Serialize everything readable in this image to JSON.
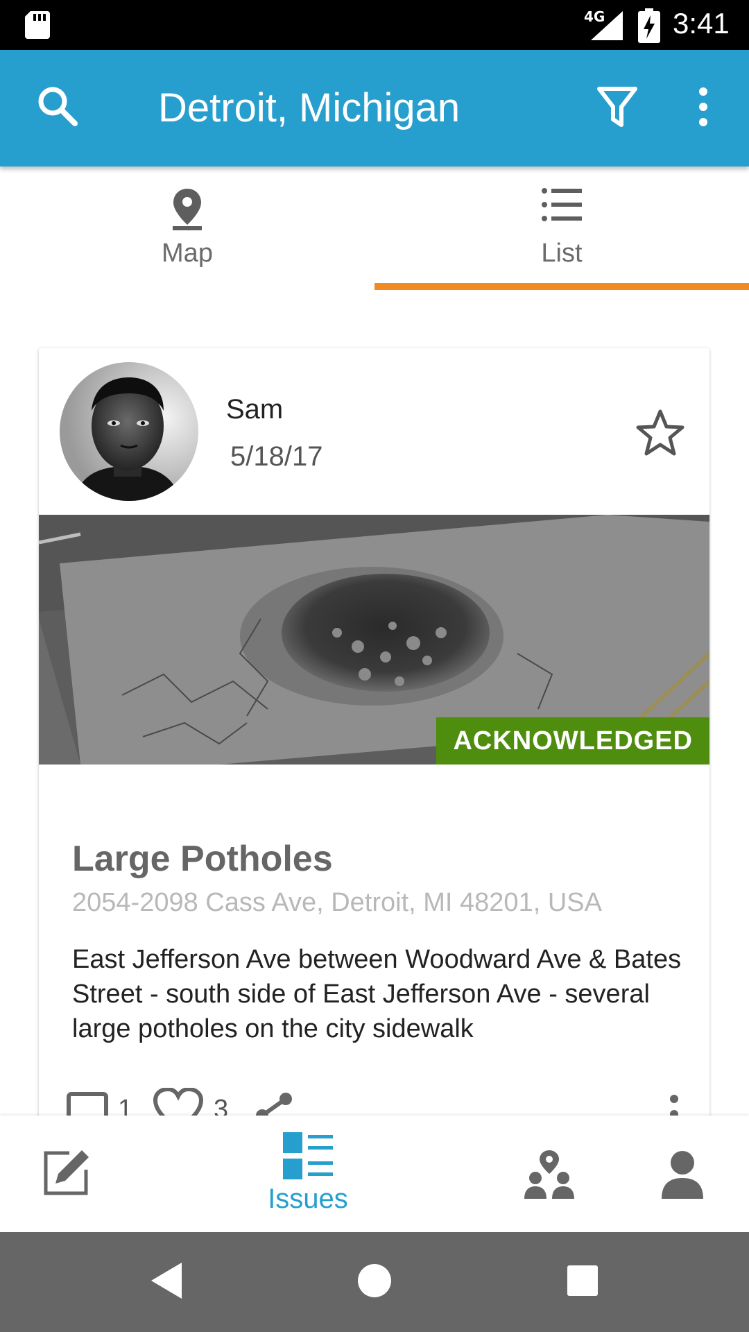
{
  "status_bar": {
    "network": "4G",
    "time": "3:41",
    "icons": [
      "sd-card-icon",
      "signal-icon",
      "battery-charging-icon"
    ]
  },
  "app_bar": {
    "title": "Detroit, Michigan",
    "icons": [
      "search-icon",
      "filter-icon",
      "more-vert-icon"
    ],
    "color": "#279fce"
  },
  "tabs": [
    {
      "label": "Map",
      "icon": "map-pin-icon",
      "selected": false
    },
    {
      "label": "List",
      "icon": "list-icon",
      "selected": true
    }
  ],
  "tab_indicator_color": "#f28a23",
  "card": {
    "user": {
      "name": "Sam",
      "date": "5/18/17"
    },
    "favorite_icon": "star-outline-icon",
    "status": "ACKNOWLEDGED",
    "status_color": "#4f8d0e",
    "title": "Large Potholes",
    "address": "2054-2098 Cass Ave, Detroit, MI 48201, USA",
    "description": "East Jefferson Ave between Woodward Ave & Bates Street - south side of East Jefferson Ave - several large potholes on the city sidewalk",
    "actions": {
      "comments": "1",
      "likes": "3",
      "icons": [
        "comment-icon",
        "heart-icon",
        "share-icon",
        "more-vert-icon"
      ]
    }
  },
  "bottom_nav": [
    {
      "label": "",
      "icon": "edit-icon",
      "active": false
    },
    {
      "label": "Issues",
      "icon": "issues-list-icon",
      "active": true
    },
    {
      "label": "",
      "icon": "community-icon",
      "active": false
    },
    {
      "label": "",
      "icon": "profile-icon",
      "active": false
    }
  ],
  "system_nav": [
    "back-icon",
    "home-icon",
    "recents-icon"
  ]
}
